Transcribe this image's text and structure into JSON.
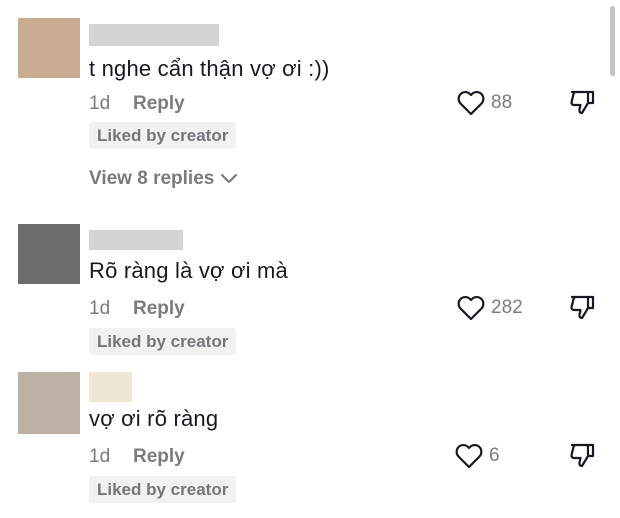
{
  "comments": [
    {
      "avatar_color": "#c8ad92",
      "name_bar_color": "#d4d4d6",
      "text": "t nghe cẩn thận vợ ơi :))",
      "time": "1d",
      "reply_label": "Reply",
      "likes": "88",
      "badge": "Liked by creator"
    },
    {
      "avatar_color": "#6e6c6b",
      "name_bar_color": "#d4d4d6",
      "text": "Rõ ràng là vợ ơi mà",
      "time": "1d",
      "reply_label": "Reply",
      "likes": "282",
      "badge": "Liked by creator"
    },
    {
      "avatar_color": "#bdb0a4",
      "name_bar_color": "#efe6d3",
      "text": "vợ ơi rõ ràng",
      "time": "1d",
      "reply_label": "Reply",
      "likes": "6",
      "badge": "Liked by creator"
    }
  ],
  "view_replies_label": "View 8 replies",
  "icons": {
    "like": "heart-outline-icon",
    "dislike": "thumbs-down-icon",
    "expand": "chevron-down-icon"
  },
  "colors": {
    "text": "#161823",
    "secondary": "#7a7b80",
    "badge_bg": "#f1f1f2"
  }
}
